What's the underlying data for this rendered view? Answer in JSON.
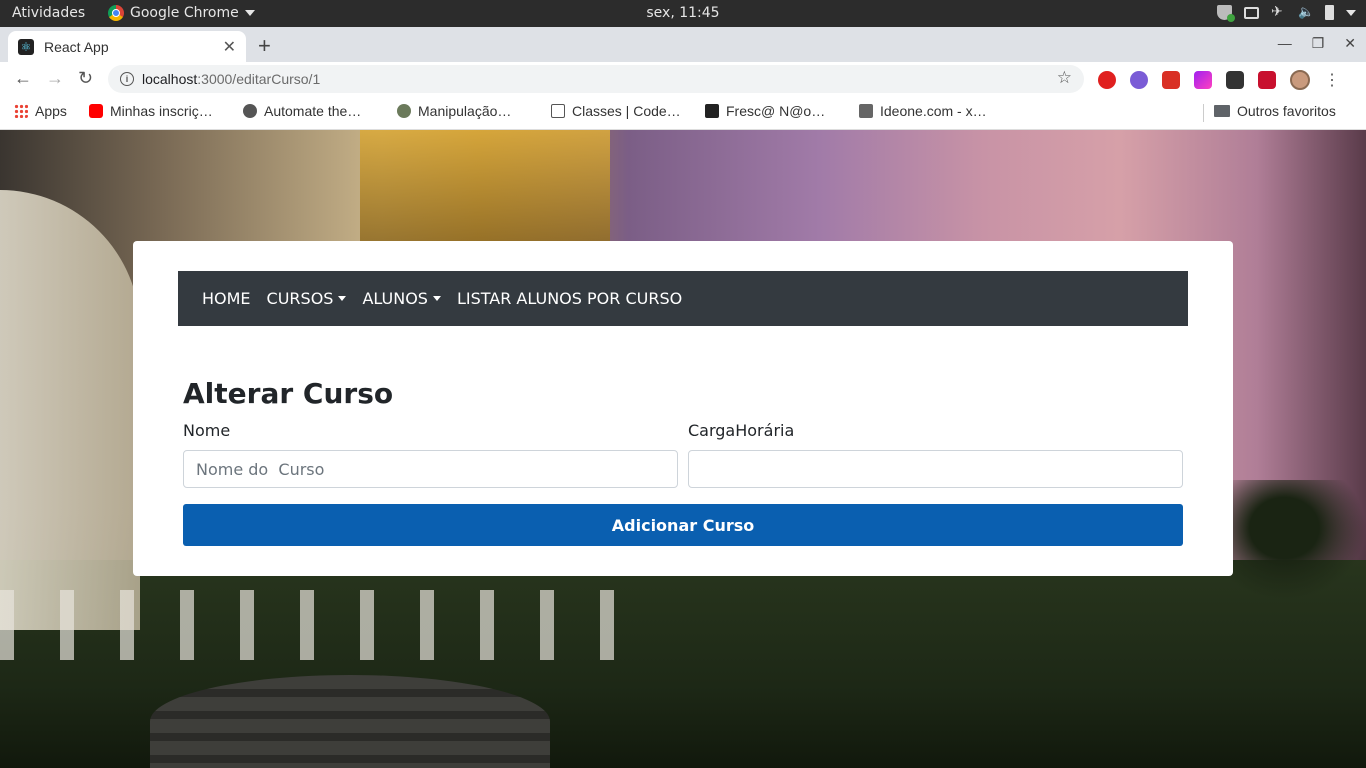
{
  "system_bar": {
    "activities": "Atividades",
    "app_name": "Google Chrome",
    "clock": "sex, 11:45"
  },
  "browser": {
    "tab_title": "React App",
    "new_tab": "+",
    "url_host": "localhost",
    "url_path": ":3000/editarCurso/1",
    "bookmarks": [
      {
        "label": "Apps",
        "icon": "apps-grid-icon"
      },
      {
        "label": "Minhas inscriç…",
        "icon": "youtube-icon"
      },
      {
        "label": "Automate the…",
        "icon": "globe-icon"
      },
      {
        "label": "Manipulação…",
        "icon": "github-icon"
      },
      {
        "label": "Classes | Code…",
        "icon": "codecademy-icon"
      },
      {
        "label": "Fresc@ N@o…",
        "icon": "fresco-icon"
      },
      {
        "label": "Ideone.com - x…",
        "icon": "ideone-icon"
      }
    ],
    "other_bookmarks": "Outros favoritos"
  },
  "navbar": {
    "items": [
      {
        "label": "HOME",
        "dropdown": false
      },
      {
        "label": "CURSOS",
        "dropdown": true
      },
      {
        "label": "ALUNOS",
        "dropdown": true
      },
      {
        "label": "LISTAR ALUNOS POR CURSO",
        "dropdown": false
      }
    ]
  },
  "form": {
    "title": "Alterar Curso",
    "name_label": "Nome",
    "name_placeholder": "Nome do  Curso",
    "name_value": "",
    "hours_label": "CargaHorária",
    "hours_value": "",
    "submit_label": "Adicionar Curso"
  },
  "colors": {
    "navbar_bg": "#343a40",
    "button_bg": "#0a5fb0",
    "card_bg": "#ffffff"
  }
}
